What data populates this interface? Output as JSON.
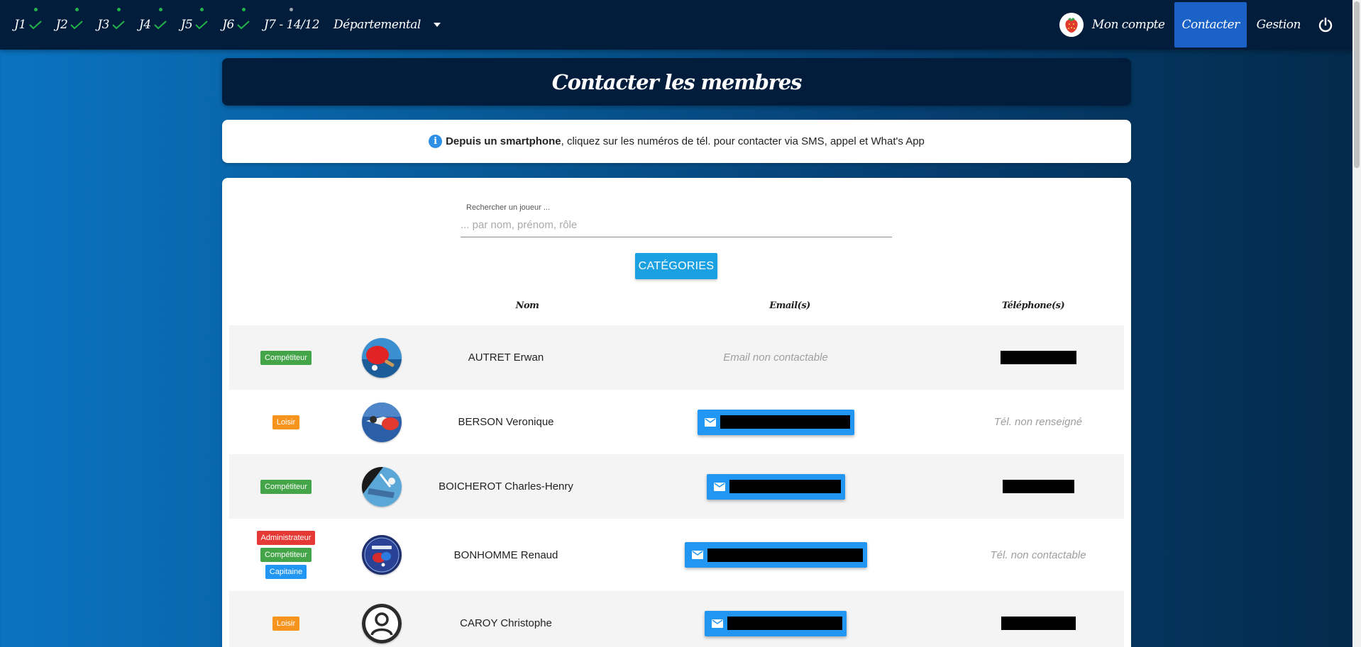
{
  "nav": {
    "journees": [
      {
        "label": "J1",
        "done": true
      },
      {
        "label": "J2",
        "done": true
      },
      {
        "label": "J3",
        "done": true
      },
      {
        "label": "J4",
        "done": true
      },
      {
        "label": "J5",
        "done": true
      },
      {
        "label": "J6",
        "done": true
      },
      {
        "label": "J7 - 14/12",
        "done": false
      }
    ],
    "championnat": "Départemental",
    "account_label": "Mon compte",
    "contact_label": "Contacter",
    "gestion_label": "Gestion",
    "icons": {
      "check": "check-icon",
      "dropdown": "caret-down-icon",
      "power": "power-icon"
    },
    "colors": {
      "navbar": "#021d3c",
      "active": "#1a62c7",
      "check": "#22b34a"
    }
  },
  "page": {
    "title": "Contacter les membres"
  },
  "info": {
    "bold": "Depuis un smartphone",
    "text": ", cliquez sur les numéros de tél. pour contacter via SMS, appel et What's App",
    "icon": "info-icon"
  },
  "search": {
    "label": "Rechercher un joueur ...",
    "placeholder": "... par nom, prénom, rôle",
    "value": ""
  },
  "categories_button": "CATÉGORIES",
  "table": {
    "headers": {
      "nom": "Nom",
      "email": "Email(s)",
      "telephone": "Téléphone(s)"
    },
    "rows": [
      {
        "badges": [
          {
            "label": "Compétiteur",
            "type": "comp"
          }
        ],
        "avatar": "ping-pong-paddle",
        "name": "AUTRET Erwan",
        "email": {
          "status": "none",
          "text": "Email non contactable"
        },
        "phone": {
          "status": "redacted",
          "text": ""
        }
      },
      {
        "badges": [
          {
            "label": "Loisir",
            "type": "loisir"
          }
        ],
        "avatar": "ping-pong-player",
        "name": "BERSON Veronique",
        "email": {
          "status": "redacted",
          "text": ""
        },
        "phone": {
          "status": "none",
          "text": "Tél. non renseigné"
        }
      },
      {
        "badges": [
          {
            "label": "Compétiteur",
            "type": "comp"
          }
        ],
        "avatar": "ping-pong-action",
        "name": "BOICHEROT Charles-Henry",
        "email": {
          "status": "redacted",
          "text": ""
        },
        "phone": {
          "status": "redacted",
          "text": ""
        }
      },
      {
        "badges": [
          {
            "label": "Administrateur",
            "type": "admin"
          },
          {
            "label": "Compétiteur",
            "type": "comp"
          },
          {
            "label": "Capitaine",
            "type": "cap"
          }
        ],
        "avatar": "ping-pong-logo",
        "name": "BONHOMME Renaud",
        "email": {
          "status": "redacted",
          "text": ""
        },
        "phone": {
          "status": "none",
          "text": "Tél. non contactable"
        }
      },
      {
        "badges": [
          {
            "label": "Loisir",
            "type": "loisir"
          }
        ],
        "avatar": "default-user",
        "name": "CAROY Christophe",
        "email": {
          "status": "redacted",
          "text": ""
        },
        "phone": {
          "status": "redacted",
          "text": ""
        }
      }
    ]
  }
}
